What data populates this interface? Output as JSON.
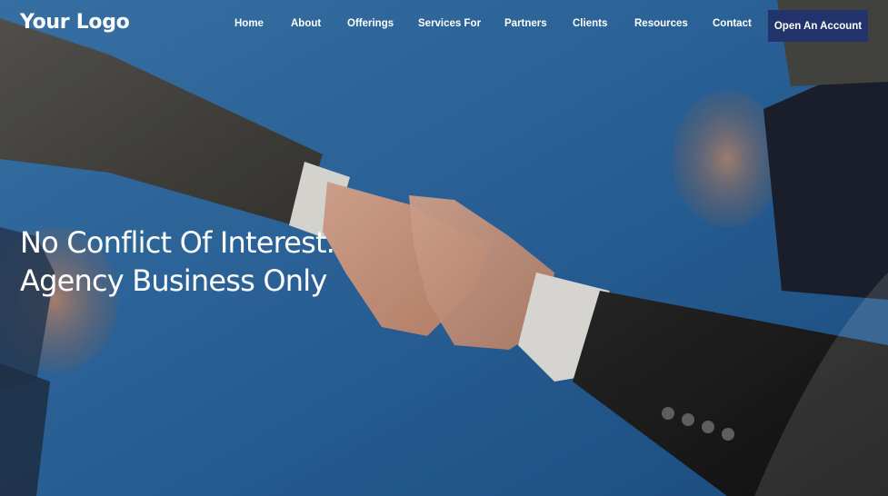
{
  "brand": {
    "logo_text": "Your Logo"
  },
  "nav": {
    "items": [
      {
        "label": "Home"
      },
      {
        "label": "About"
      },
      {
        "label": "Offerings"
      },
      {
        "label": "Services For"
      },
      {
        "label": "Partners"
      },
      {
        "label": "Clients"
      },
      {
        "label": "Resources"
      },
      {
        "label": "Contact"
      }
    ],
    "cta_label": "Open An Account"
  },
  "hero": {
    "headline_line1": "No Conflict Of Interest.",
    "headline_line2": "Agency Business Only",
    "image_description_icon": "handshake-photo"
  },
  "colors": {
    "sky": "#2f6eaa",
    "cta_background": "#22346b",
    "text": "#ffffff"
  }
}
